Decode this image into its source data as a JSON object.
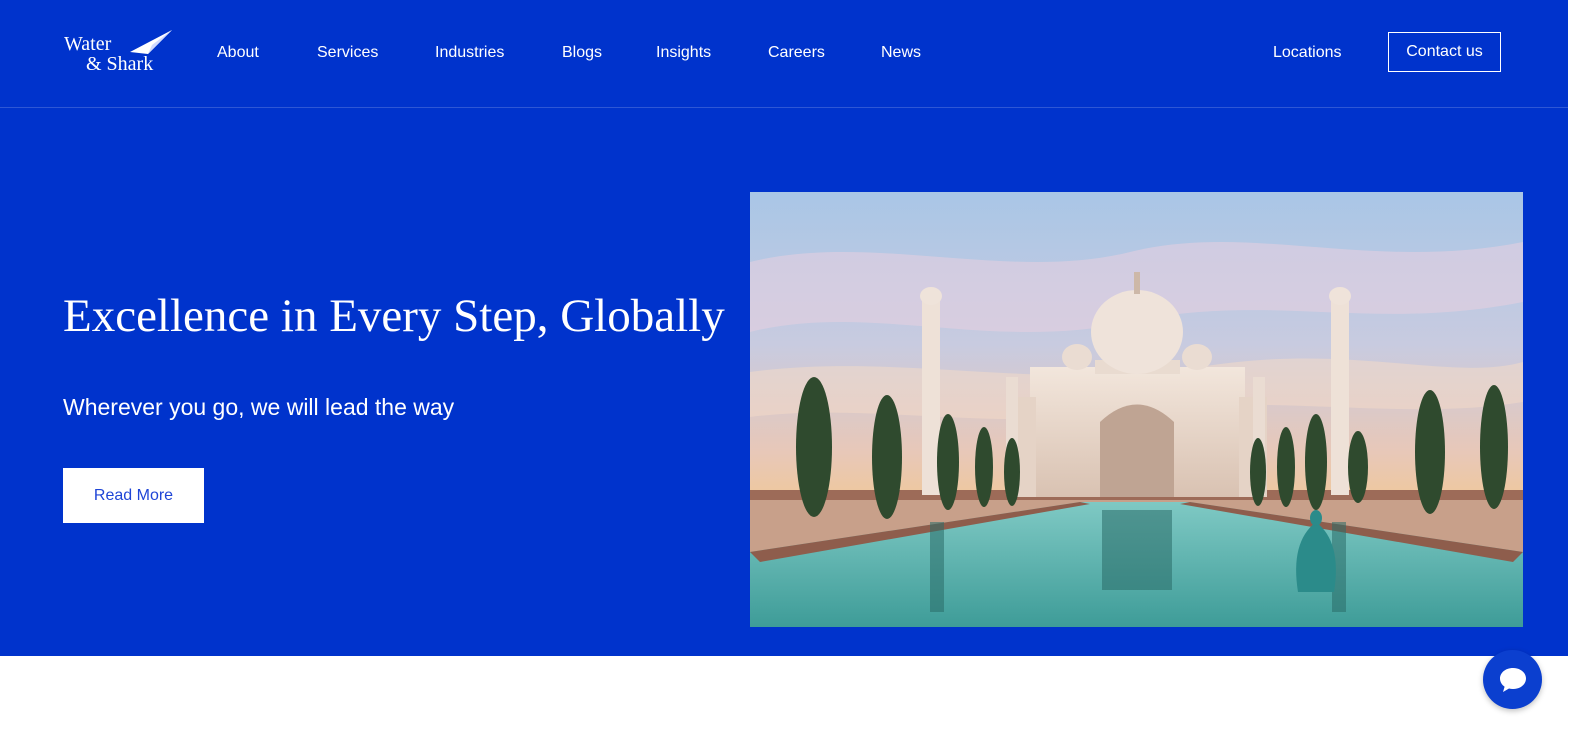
{
  "brand": {
    "line1": "Water",
    "line2": "& Shark"
  },
  "nav": {
    "items": [
      "About",
      "Services",
      "Industries",
      "Blogs",
      "Insights",
      "Careers",
      "News"
    ],
    "locations": "Locations",
    "contact": "Contact us"
  },
  "hero": {
    "title": "Excellence in Every Step, Globally",
    "subtitle": "Wherever you go, we will lead the way",
    "cta": "Read More"
  },
  "colors": {
    "brand_blue": "#0033cc",
    "cta_text": "#1f45d6",
    "white": "#ffffff"
  },
  "icons": {
    "chat": "chat-bubble-icon"
  }
}
